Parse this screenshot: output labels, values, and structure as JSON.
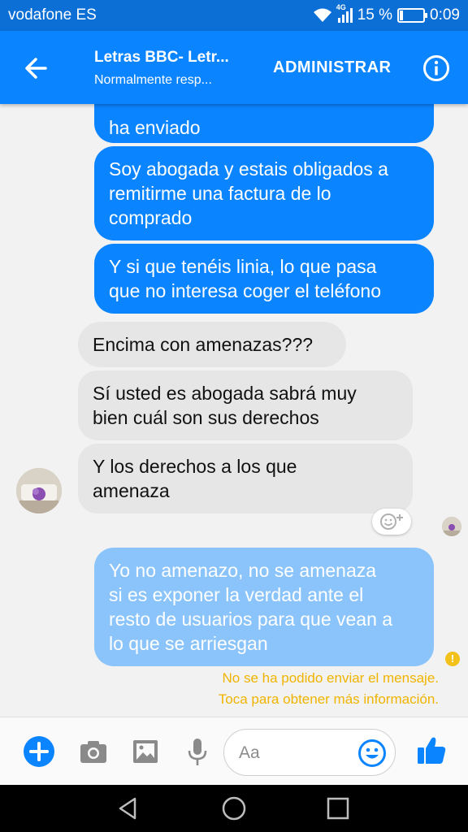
{
  "status_bar": {
    "carrier": "vodafone ES",
    "network_label": "4G",
    "battery_percent": "15 %",
    "battery_level": 0.15,
    "time": "0:09"
  },
  "header": {
    "back_icon": "arrow-left-icon",
    "title": "Letras BBC- Letr...",
    "subtitle": "Normalmente resp...",
    "admin_label": "ADMINISTRAR",
    "info_icon": "info-icon"
  },
  "messages": [
    {
      "direction": "outgoing",
      "lines": [
        "ha enviado"
      ]
    },
    {
      "direction": "outgoing",
      "lines": [
        "Soy abogada y estais obligados a",
        "remitirme una factura de lo",
        "comprado"
      ]
    },
    {
      "direction": "outgoing",
      "lines": [
        "Y si que tenéis linia, lo que pasa",
        "que no interesa coger el teléfono"
      ]
    },
    {
      "direction": "incoming",
      "lines": [
        "Encima con amenazas???"
      ]
    },
    {
      "direction": "incoming",
      "lines": [
        "Sí usted es abogada sabrá muy",
        "bien cuál son sus derechos"
      ]
    },
    {
      "direction": "incoming",
      "lines": [
        "Y los derechos a los que",
        "amenaza"
      ]
    },
    {
      "direction": "outgoing-failed",
      "lines": [
        "Yo no amenazo, no se amenaza",
        "si es exponer la verdad ante el",
        "resto de usuarios para que vean a",
        "lo que se arriesgan"
      ]
    }
  ],
  "error": {
    "icon": "exclamation-icon",
    "line1": "No se ha podido enviar el mensaje.",
    "line2": "Toca para obtener más información."
  },
  "composer": {
    "placeholder": "Aa",
    "icons": [
      "plus-icon",
      "camera-icon",
      "image-icon",
      "microphone-icon",
      "emoji-icon",
      "thumbs-up-icon"
    ]
  },
  "colors": {
    "status_bar": "#0c6fd6",
    "header": "#0b84ff",
    "outgoing_bubble": "#0b84ff",
    "failed_bubble": "#8ac4fb",
    "incoming_bubble": "#e6e6e6",
    "error_text": "#f0b400"
  }
}
